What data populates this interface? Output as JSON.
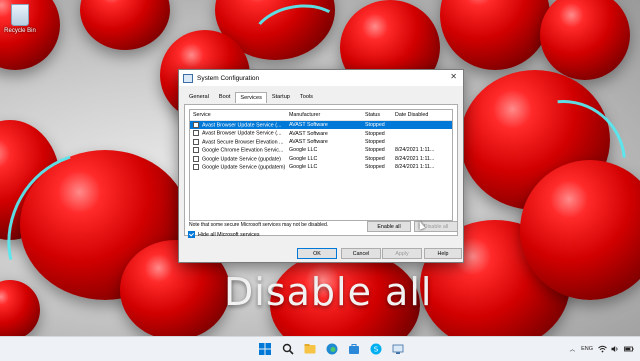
{
  "desktop": {
    "recycle_bin_label": "Recycle Bin",
    "caption": "Disable all"
  },
  "dialog": {
    "title": "System Configuration",
    "close_glyph": "✕",
    "tabs": [
      "General",
      "Boot",
      "Services",
      "Startup",
      "Tools"
    ],
    "active_tab": "Services",
    "columns": [
      "Service",
      "Manufacturer",
      "Status",
      "Date Disabled"
    ],
    "rows": [
      {
        "service": "Avast Browser Update Service (...",
        "manufacturer": "AVAST Software",
        "status": "Stopped",
        "date": "",
        "selected": true
      },
      {
        "service": "Avast Browser Update Service (...",
        "manufacturer": "AVAST Software",
        "status": "Stopped",
        "date": "",
        "selected": false
      },
      {
        "service": "Avast Secure Browser Elevation ...",
        "manufacturer": "AVAST Software",
        "status": "Stopped",
        "date": "",
        "selected": false
      },
      {
        "service": "Google Chrome Elevation Servic...",
        "manufacturer": "Google LLC",
        "status": "Stopped",
        "date": "8/24/2021 1:11...",
        "selected": false
      },
      {
        "service": "Google Update Service (gupdate)",
        "manufacturer": "Google LLC",
        "status": "Stopped",
        "date": "8/24/2021 1:11...",
        "selected": false
      },
      {
        "service": "Google Update Service (gupdatem)",
        "manufacturer": "Google LLC",
        "status": "Stopped",
        "date": "8/24/2021 1:11...",
        "selected": false
      }
    ],
    "note": "Note that some secure Microsoft services may not be disabled.",
    "enable_all": "Enable all",
    "disable_all": "Disable all",
    "hide_ms_label": "Hide all Microsoft services",
    "hide_ms_checked": true,
    "ok": "OK",
    "cancel": "Cancel",
    "apply": "Apply",
    "help": "Help"
  },
  "taskbar": {
    "icons": [
      "windows-start-icon",
      "search-icon",
      "file-explorer-icon",
      "edge-icon",
      "store-icon",
      "skype-icon",
      "system-configuration-icon"
    ],
    "language": "ENG"
  },
  "colors": {
    "accent": "#0078d7",
    "sphere_red": "#d10000",
    "stripe": "#59e8ef"
  }
}
